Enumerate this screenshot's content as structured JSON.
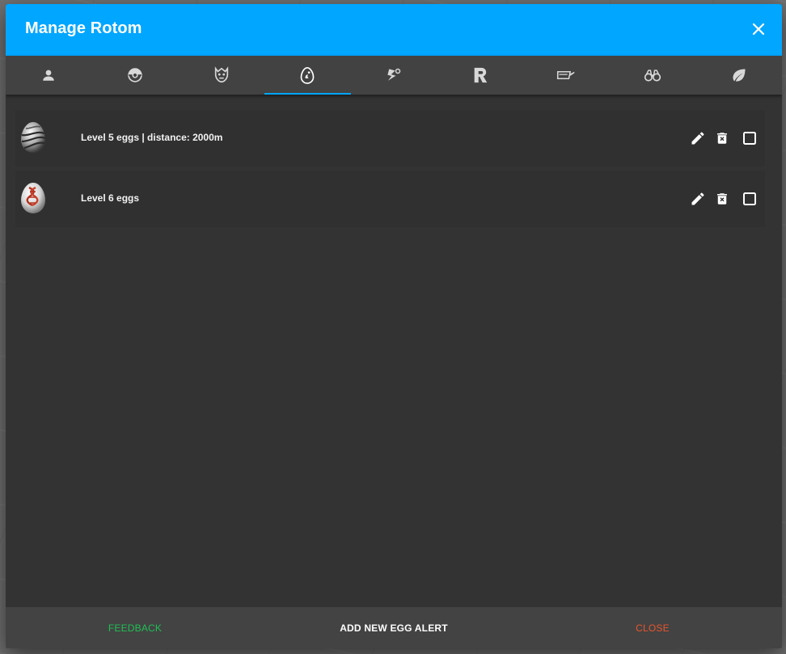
{
  "dialog": {
    "title": "Manage Rotom",
    "close_icon": "close-icon"
  },
  "tabs": [
    {
      "icon": "person-icon",
      "active": false
    },
    {
      "icon": "pokeball-icon",
      "active": false
    },
    {
      "icon": "raid-boss-icon",
      "active": false
    },
    {
      "icon": "egg-icon",
      "active": true
    },
    {
      "icon": "quest-icon",
      "active": false
    },
    {
      "icon": "rocket-r-icon",
      "active": false
    },
    {
      "icon": "lure-icon",
      "active": false
    },
    {
      "icon": "binoculars-icon",
      "active": false
    },
    {
      "icon": "leaf-icon",
      "active": false
    }
  ],
  "alerts": [
    {
      "label": "Level 5 eggs | distance: 2000m",
      "egg_icon": "level-5-egg-icon"
    },
    {
      "label": "Level 6 eggs",
      "egg_icon": "level-6-egg-icon"
    }
  ],
  "footer": {
    "feedback": "FEEDBACK",
    "add": "ADD NEW EGG ALERT",
    "close": "CLOSE"
  },
  "colors": {
    "accent": "#00a6ff",
    "feedback": "#1fbf55",
    "close": "#e8552e",
    "dialog_bg": "#333333"
  }
}
